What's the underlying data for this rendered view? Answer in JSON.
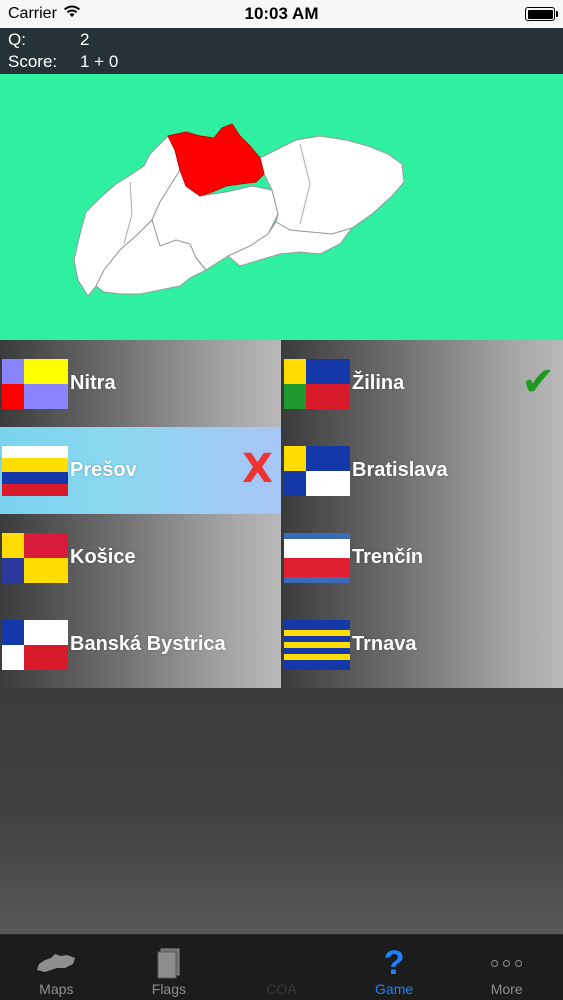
{
  "status": {
    "carrier": "Carrier",
    "time": "10:03 AM"
  },
  "header": {
    "q_label": "Q:",
    "q_value": "2",
    "score_label": "Score:",
    "score_value": "1 + 0"
  },
  "colors": {
    "map_background": "#2ef0a0",
    "highlight_region": "#ff0000",
    "tab_active": "#1a82ff"
  },
  "answers": [
    {
      "label": "Nitra",
      "mark": ""
    },
    {
      "label": "Žilina",
      "mark": "✔"
    },
    {
      "label": "Prešov",
      "mark": "X"
    },
    {
      "label": "Bratislava",
      "mark": ""
    },
    {
      "label": "Košice",
      "mark": ""
    },
    {
      "label": "Trenčín",
      "mark": ""
    },
    {
      "label": "Banská Bystrica",
      "mark": ""
    },
    {
      "label": "Trnava",
      "mark": ""
    }
  ],
  "tabs": [
    {
      "label": "Maps",
      "icon": "map-icon"
    },
    {
      "label": "Flags",
      "icon": "flags-icon"
    },
    {
      "label": "COA",
      "icon": "coa-icon"
    },
    {
      "label": "Game",
      "icon": "question-icon",
      "glyph": "?"
    },
    {
      "label": "More",
      "icon": "more-icon"
    }
  ]
}
